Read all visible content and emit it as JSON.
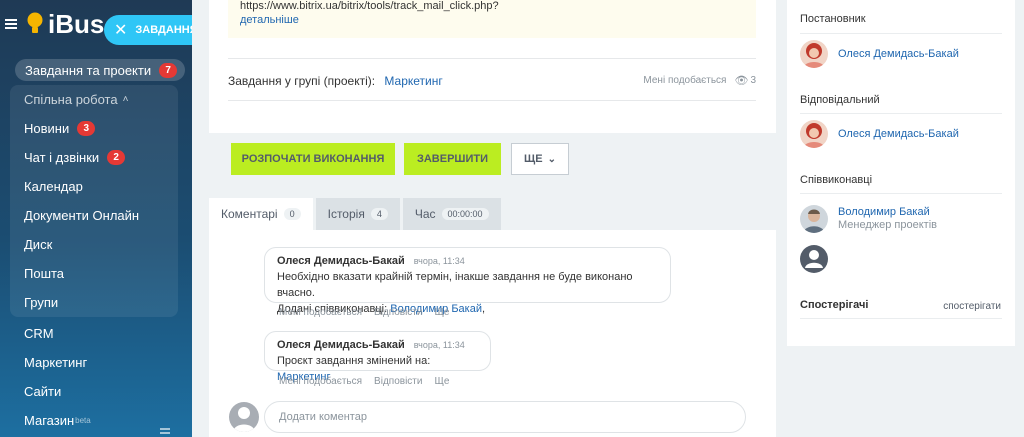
{
  "sidebar": {
    "logo": "iBus",
    "task_button": "ЗАВДАННЯ",
    "projects": {
      "label": "Завдання та проекти",
      "badge": "7"
    },
    "group_header": "Спільна робота",
    "items": [
      {
        "label": "Новини",
        "badge": "3"
      },
      {
        "label": "Чат і дзвінки",
        "badge": "2"
      },
      {
        "label": "Календар"
      },
      {
        "label": "Документи Онлайн"
      },
      {
        "label": "Диск"
      },
      {
        "label": "Пошта"
      },
      {
        "label": "Групи"
      },
      {
        "label": "CRM"
      },
      {
        "label": "Маркетинг"
      },
      {
        "label": "Сайти"
      },
      {
        "label": "Магазин",
        "sup": "beta"
      }
    ]
  },
  "task": {
    "url_text": "https://www.bitrix.ua/bitrix/tools/track_mail_click.php?",
    "more_link": "детальніше",
    "group_label": "Завдання у групі (проекті):",
    "group_link": "Маркетинг",
    "like_text": "Мені подобається",
    "views": "3"
  },
  "actions": {
    "start": "РОЗПОЧАТИ ВИКОНАННЯ",
    "finish": "ЗАВЕРШИТИ",
    "more": "ЩЕ"
  },
  "tabs": [
    {
      "label": "Коментарі",
      "count": "0"
    },
    {
      "label": "Історія",
      "count": "4"
    },
    {
      "label": "Час",
      "count": "00:00:00"
    }
  ],
  "comments": [
    {
      "author": "Олеся Демидась-Бакай",
      "time": "вчора, 11:34",
      "line1": "Необхідно вказати крайній термін, інакше завдання не буде виконано вчасно.",
      "line2_prefix": "Додані співвиконавці:",
      "line2_link": "Володимир Бакай",
      "line2_suffix": ","
    },
    {
      "author": "Олеся Демидась-Бакай",
      "time": "вчора, 11:34",
      "line1_prefix": "Проєкт завдання змінений на:",
      "line1_link": "Маркетинг"
    }
  ],
  "comment_actions": {
    "like": "Мені подобається",
    "reply": "Відповісти",
    "more": "Ще"
  },
  "add_comment_placeholder": "Додати коментар",
  "right_panel": {
    "creator_title": "Постановник",
    "creator_name": "Олеся Демидась-Бакай",
    "responsible_title": "Відповідальний",
    "responsible_name": "Олеся Демидась-Бакай",
    "participants_title": "Співвиконавці",
    "participant_name": "Володимир Бакай",
    "participant_role": "Менеджер проектів",
    "observers_title": "Спостерігачі",
    "observe_link": "спостерігати"
  },
  "colors": {
    "accent": "#2fc6f6",
    "green": "#bbed21",
    "link": "#2067b0",
    "badge": "#e53935"
  }
}
